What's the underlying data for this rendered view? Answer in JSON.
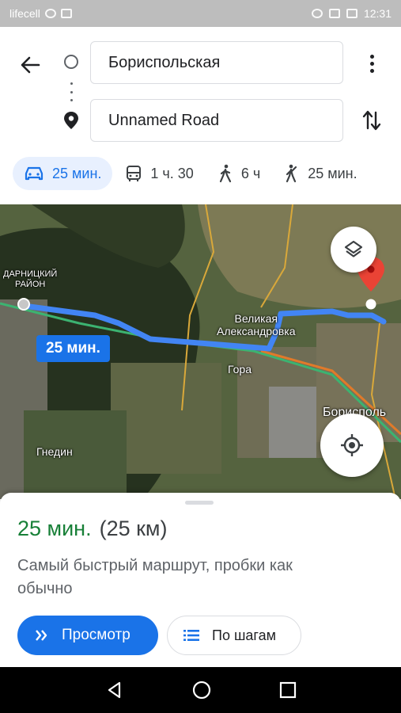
{
  "status_bar": {
    "carrier": "lifecell",
    "time": "12:31"
  },
  "directions": {
    "origin": "Бориспольская",
    "destination": "Unnamed Road"
  },
  "travel_modes": [
    {
      "icon": "car-icon",
      "label": "25 мин.",
      "selected": true
    },
    {
      "icon": "bus-icon",
      "label": "1 ч. 30",
      "selected": false
    },
    {
      "icon": "walk-icon",
      "label": "6 ч",
      "selected": false
    },
    {
      "icon": "ride-hail-icon",
      "label": "25 мин.",
      "selected": false
    }
  ],
  "map": {
    "route_badge": "25 мин.",
    "labels": {
      "darnytskyi": "ДАРНИЦКИЙ\nРАЙОН",
      "velykaya": "Великая\nАлександровка",
      "gora": "Гора",
      "boryspil": "Борисполь",
      "gnedin": "Гнедин"
    },
    "route_color": "#4285f4"
  },
  "route_summary": {
    "duration": "25 мин.",
    "distance": "(25 км)",
    "description": "Самый быстрый маршрут, пробки как обычно",
    "preview_label": "Просмотр",
    "steps_label": "По шагам",
    "duration_color": "#188038",
    "accent_color": "#1a73e8"
  }
}
